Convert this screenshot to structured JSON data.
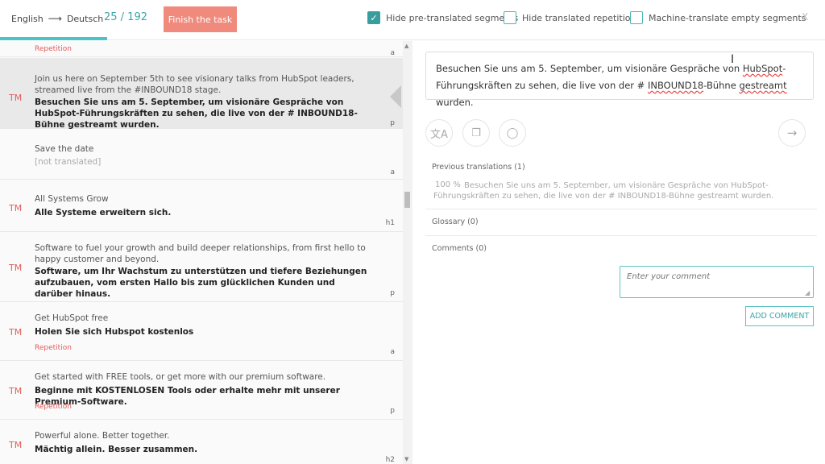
{
  "header": {
    "source_lang": "English",
    "target_lang": "Deutsch",
    "progress_text": "25 / 192",
    "progress_fraction": 0.13,
    "finish_label": "Finish the task",
    "options": [
      {
        "label": "Hide pre-translated segments",
        "checked": true
      },
      {
        "label": "Hide translated repetitions",
        "checked": false
      },
      {
        "label": "Machine-translate empty segments",
        "checked": false
      }
    ],
    "close_label": "X"
  },
  "segments": [
    {
      "tm": "",
      "source": "",
      "target": "",
      "note": "Repetition",
      "placeholder": "",
      "tag": "a",
      "active": false
    },
    {
      "tm": "TM",
      "source": "Join us here on September 5th to see visionary talks from HubSpot leaders, streamed live from the #INBOUND18 stage.",
      "target": "Besuchen Sie uns am 5. September, um visionäre Gespräche von HubSpot-Führungskräften zu sehen, die live von der # INBOUND18-Bühne gestreamt wurden.",
      "note": "",
      "placeholder": "",
      "tag": "p",
      "active": true
    },
    {
      "tm": "",
      "source": "Save the date",
      "target": "",
      "note": "",
      "placeholder": "[not translated]",
      "tag": "a",
      "active": false
    },
    {
      "tm": "TM",
      "source": "All Systems Grow",
      "target": "Alle Systeme erweitern sich.",
      "note": "",
      "placeholder": "",
      "tag": "h1",
      "active": false
    },
    {
      "tm": "TM",
      "source": "Software to fuel your growth and build deeper relationships, from first hello to happy customer and beyond.",
      "target": "Software, um Ihr Wachstum zu unterstützen und tiefere Beziehungen aufzubauen, vom ersten Hallo bis zum glücklichen Kunden und darüber hinaus.",
      "note": "",
      "placeholder": "",
      "tag": "p",
      "active": false
    },
    {
      "tm": "TM",
      "source": "Get HubSpot free",
      "target": "Holen Sie sich Hubspot kostenlos",
      "note": "Repetition",
      "placeholder": "",
      "tag": "a",
      "active": false
    },
    {
      "tm": "TM",
      "source": "Get started with FREE tools, or get more with our premium software.",
      "target": "Beginne mit KOSTENLOSEN Tools oder erhalte mehr mit unserer Premium-Software.",
      "note": "Repetition",
      "placeholder": "",
      "tag": "p",
      "active": false
    },
    {
      "tm": "TM",
      "source": "Powerful alone. Better together.",
      "target": "Mächtig allein. Besser zusammen.",
      "note": "",
      "placeholder": "",
      "tag": "h2",
      "active": false
    }
  ],
  "editor": {
    "text_part1": "Besuchen Sie uns am 5. September, um visionäre Gespräche von ",
    "spell1": "HubSpot",
    "text_part2": "-Führungskräften zu sehen, die live von der # ",
    "spell2": "INBOUND18",
    "text_part3": "-Bühne ",
    "spell3": "gestreamt",
    "text_part4": " wurden."
  },
  "tools": [
    {
      "name": "translate-icon",
      "glyph": "文A"
    },
    {
      "name": "copy-icon",
      "glyph": "❐"
    },
    {
      "name": "comment-icon",
      "glyph": "◯"
    }
  ],
  "next_glyph": "→",
  "previous_translations": {
    "label": "Previous translations (1)",
    "percent": "100 %",
    "text": "Besuchen Sie uns am 5. September, um visionäre Gespräche von HubSpot-Führungskräften zu sehen, die live von der # INBOUND18-Bühne gestreamt wurden."
  },
  "glossary_label": "Glossary (0)",
  "comments_label": "Comments (0)",
  "comment_placeholder": "Enter your comment",
  "add_comment_label": "ADD COMMENT",
  "colors": {
    "accent": "#3aa6a6",
    "finish": "#f08a7d",
    "tm": "#e25d5d"
  }
}
